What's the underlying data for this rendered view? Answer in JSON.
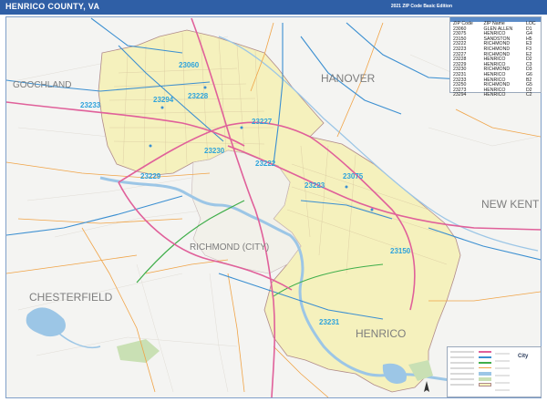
{
  "title": "HENRICO COUNTY, VA",
  "edition": "2021 ZIP Code Basic Edition",
  "colors": {
    "title_bg": "#2f5fa6",
    "county_fill": "#f5f1bd",
    "outside_fill": "#f4f4f2",
    "water": "#9cc6e6",
    "interstate": "#e0609a",
    "highway_blue": "#3b8fd1",
    "highway_green": "#3fae4a",
    "road_orange": "#f0a346",
    "zip_label": "#2ea3dc"
  },
  "zip_table": {
    "headers": [
      "ZIP Code",
      "ZIP Name",
      "LOC"
    ],
    "rows": [
      [
        "23060",
        "GLEN ALLEN",
        "D1"
      ],
      [
        "23075",
        "HENRICO",
        "G4"
      ],
      [
        "23150",
        "SANDSTON",
        "H5"
      ],
      [
        "23222",
        "RICHMOND",
        "E3"
      ],
      [
        "23223",
        "RICHMOND",
        "F3"
      ],
      [
        "23227",
        "RICHMOND",
        "E2"
      ],
      [
        "23228",
        "HENRICO",
        "D2"
      ],
      [
        "23229",
        "HENRICO",
        "C3"
      ],
      [
        "23230",
        "RICHMOND",
        "D3"
      ],
      [
        "23231",
        "HENRICO",
        "G6"
      ],
      [
        "23233",
        "HENRICO",
        "B2"
      ],
      [
        "23250",
        "RICHMOND",
        "G5"
      ],
      [
        "23273",
        "HENRICO",
        "D2"
      ],
      [
        "23294",
        "HENRICO",
        "C2"
      ]
    ]
  },
  "region_labels": [
    "GOOCHLAND",
    "HANOVER",
    "NEW KENT",
    "CHESTERFIELD",
    "RICHMOND (CITY)",
    "HENRICO"
  ],
  "zip_labels": [
    "23060",
    "23233",
    "23294",
    "23228",
    "23227",
    "23230",
    "23222",
    "23229",
    "23223",
    "23075",
    "23150",
    "23231"
  ],
  "logo_text": "City"
}
